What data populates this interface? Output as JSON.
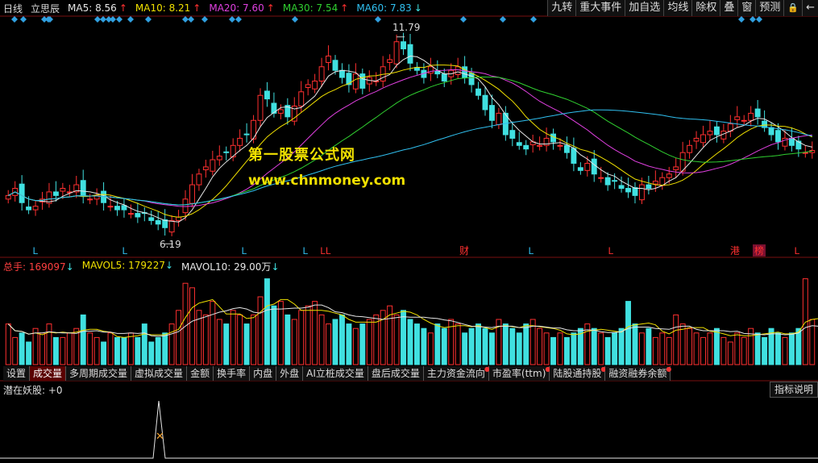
{
  "header": {
    "period": "日线",
    "stock_name": "立思辰",
    "ma": [
      {
        "label": "MA5: 8.56",
        "arrow": "↑",
        "color": "#e6e6e6"
      },
      {
        "label": "MA10: 8.21",
        "arrow": "↑",
        "color": "#f0e000"
      },
      {
        "label": "MA20: 7.60",
        "arrow": "↑",
        "color": "#e040e0"
      },
      {
        "label": "MA30: 7.54",
        "arrow": "↑",
        "color": "#30d030"
      },
      {
        "label": "MA60: 7.83",
        "arrow": "↓",
        "color": "#30c0f0"
      }
    ]
  },
  "toolbar": [
    "九转",
    "重大事件",
    "加自选",
    "均线",
    "除权",
    "叠",
    "窗",
    "预测",
    "",
    ""
  ],
  "annotations": {
    "high_label": "11.79",
    "low_label": "6.19",
    "markers": [
      "L",
      "L",
      "L",
      "L",
      "LL",
      "财",
      "L",
      "L",
      "港",
      "榜",
      "L"
    ]
  },
  "watermark": {
    "line1": "第一股票公式网",
    "line2": "www.chnmoney.com"
  },
  "volume": {
    "total": {
      "label": "总手: 169097",
      "arrow": "↓",
      "color": "#ff4040"
    },
    "mavol5": {
      "label": "MAVOL5: 179227",
      "arrow": "↓",
      "color": "#f0e000"
    },
    "mavol10": {
      "label": "MAVOL10: 29.00万",
      "arrow": "↓",
      "color": "#e6e6e6"
    }
  },
  "tabs": [
    {
      "label": "设置",
      "dot": false,
      "active": false
    },
    {
      "label": "成交量",
      "dot": false,
      "active": true
    },
    {
      "label": "多周期成交量",
      "dot": false,
      "active": false
    },
    {
      "label": "虚拟成交量",
      "dot": false,
      "active": false
    },
    {
      "label": "金额",
      "dot": false,
      "active": false
    },
    {
      "label": "换手率",
      "dot": false,
      "active": false
    },
    {
      "label": "内盘",
      "dot": false,
      "active": false
    },
    {
      "label": "外盘",
      "dot": false,
      "active": false
    },
    {
      "label": "AI立桩成交量",
      "dot": false,
      "active": false
    },
    {
      "label": "盘后成交量",
      "dot": false,
      "active": false
    },
    {
      "label": "主力资金流向",
      "dot": true,
      "active": false
    },
    {
      "label": "市盈率(ttm)",
      "dot": true,
      "active": false
    },
    {
      "label": "陆股通持股",
      "dot": true,
      "active": false
    },
    {
      "label": "融资融券余额",
      "dot": true,
      "active": false
    }
  ],
  "indicator": {
    "label": "潜在妖股: +0",
    "button": "指标说明"
  },
  "colors": {
    "up": "#ff3030",
    "down": "#40e0e0",
    "ma5": "#e6e6e6",
    "ma10": "#f0e000",
    "ma20": "#e040e0",
    "ma30": "#30d030",
    "ma60": "#30c0f0",
    "diamond": "#30a0e0"
  },
  "series": {
    "close": [
      7.3,
      7.5,
      7.1,
      6.9,
      7.0,
      7.2,
      7.4,
      7.3,
      7.5,
      7.4,
      7.6,
      7.3,
      7.2,
      7.3,
      7.1,
      7.0,
      6.9,
      6.9,
      6.8,
      6.7,
      6.8,
      6.6,
      6.5,
      6.4,
      6.6,
      6.7,
      7.2,
      7.6,
      7.9,
      8.1,
      8.3,
      8.4,
      8.5,
      8.7,
      8.9,
      9.0,
      9.4,
      10.1,
      10.0,
      9.6,
      9.7,
      9.5,
      9.8,
      10.2,
      10.4,
      10.5,
      10.9,
      11.2,
      10.8,
      10.6,
      10.4,
      10.7,
      10.3,
      10.6,
      10.5,
      10.9,
      11.1,
      11.6,
      11.4,
      11.0,
      10.8,
      10.6,
      10.9,
      10.7,
      10.5,
      10.8,
      10.9,
      10.6,
      10.4,
      10.1,
      9.7,
      9.4,
      9.6,
      9.0,
      8.9,
      8.7,
      8.6,
      8.8,
      8.7,
      8.9,
      8.8,
      8.7,
      8.5,
      8.2,
      8.0,
      8.2,
      7.9,
      7.8,
      7.6,
      7.7,
      7.5,
      7.4,
      7.3,
      7.6,
      7.5,
      7.7,
      7.8,
      7.9,
      8.1,
      8.5,
      8.7,
      8.9,
      9.0,
      9.1,
      9.0,
      9.1,
      9.3,
      9.5,
      9.4,
      9.6,
      9.5,
      9.2,
      9.0,
      8.8,
      8.9,
      8.7,
      8.6,
      8.5,
      8.56
    ],
    "volume": [
      0.45,
      0.3,
      0.35,
      0.25,
      0.4,
      0.35,
      0.45,
      0.3,
      0.3,
      0.35,
      0.4,
      0.55,
      0.35,
      0.3,
      0.25,
      0.35,
      0.3,
      0.3,
      0.35,
      0.3,
      0.45,
      0.25,
      0.3,
      0.35,
      0.45,
      0.6,
      0.9,
      0.85,
      0.6,
      0.55,
      0.7,
      0.5,
      0.45,
      0.6,
      0.55,
      0.45,
      0.55,
      0.75,
      0.95,
      0.65,
      0.7,
      0.55,
      0.5,
      0.6,
      0.65,
      0.7,
      0.55,
      0.45,
      0.5,
      0.55,
      0.45,
      0.4,
      0.45,
      0.5,
      0.55,
      0.6,
      0.65,
      0.55,
      0.6,
      0.5,
      0.45,
      0.4,
      0.35,
      0.45,
      0.4,
      0.5,
      0.45,
      0.35,
      0.4,
      0.45,
      0.4,
      0.35,
      0.5,
      0.45,
      0.4,
      0.35,
      0.45,
      0.5,
      0.4,
      0.35,
      0.3,
      0.35,
      0.3,
      0.35,
      0.4,
      0.45,
      0.4,
      0.35,
      0.3,
      0.35,
      0.4,
      0.7,
      0.45,
      0.35,
      0.4,
      0.3,
      0.35,
      0.3,
      0.55,
      0.45,
      0.4,
      0.35,
      0.3,
      0.35,
      0.4,
      0.3,
      0.25,
      0.35,
      0.3,
      0.4,
      0.35,
      0.3,
      0.4,
      0.35,
      0.3,
      0.35,
      0.4,
      0.95,
      0.5,
      0.35,
      0.4,
      0.3,
      0.25
    ]
  }
}
